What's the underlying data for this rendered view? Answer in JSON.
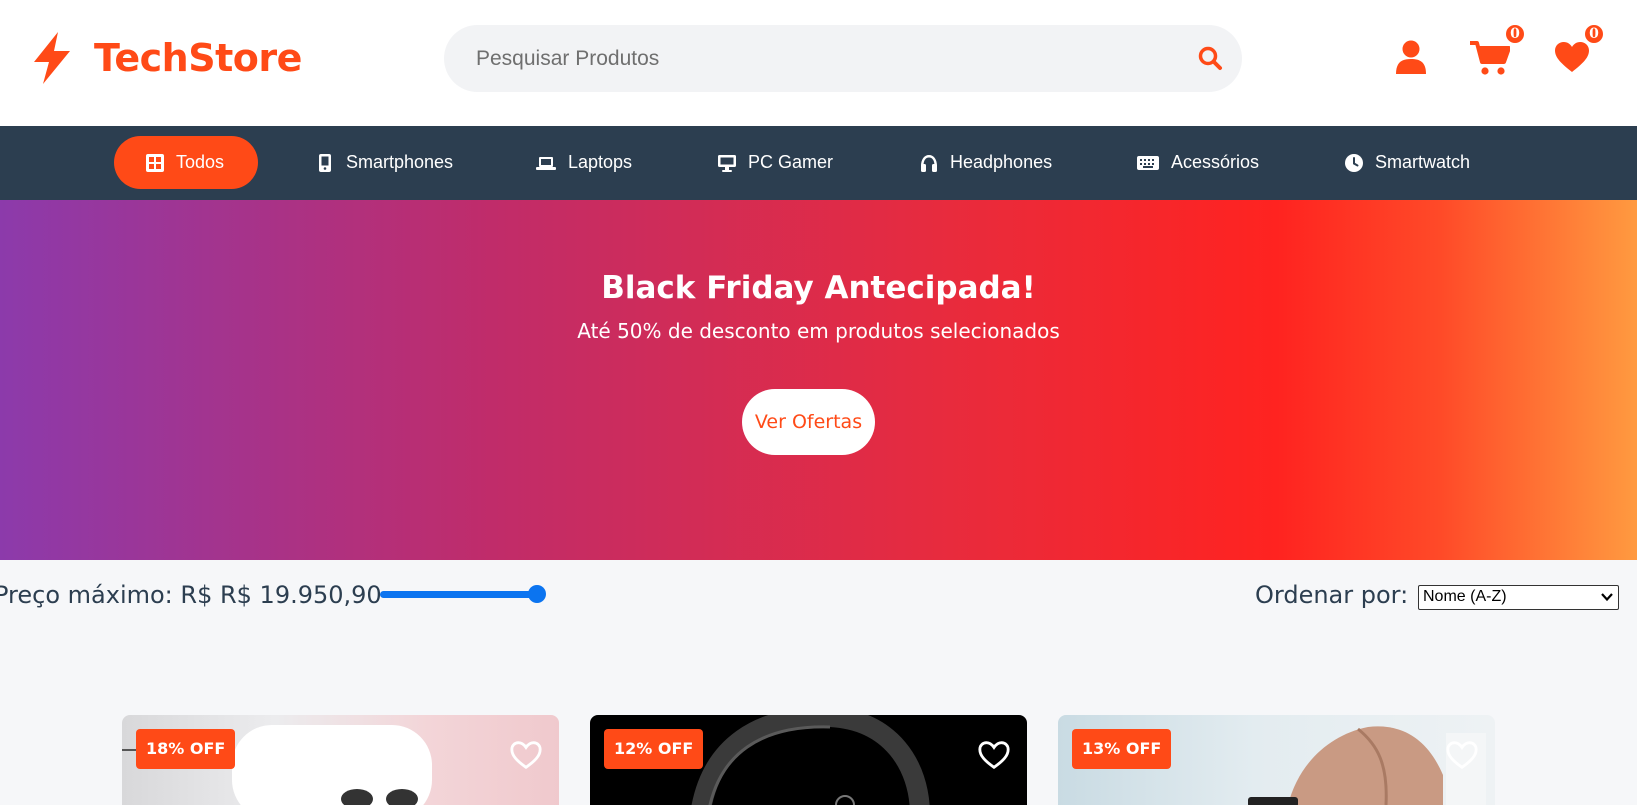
{
  "header": {
    "brand": "TechStore",
    "search_placeholder": "Pesquisar Produtos",
    "cart_count": "0",
    "wishlist_count": "0"
  },
  "nav": {
    "items": [
      {
        "label": "Todos",
        "icon": "grid-icon"
      },
      {
        "label": "Smartphones",
        "icon": "mobile-icon"
      },
      {
        "label": "Laptops",
        "icon": "laptop-icon"
      },
      {
        "label": "PC Gamer",
        "icon": "desktop-icon"
      },
      {
        "label": "Headphones",
        "icon": "headphones-icon"
      },
      {
        "label": "Acessórios",
        "icon": "keyboard-icon"
      },
      {
        "label": "Smartwatch",
        "icon": "clock-icon"
      }
    ]
  },
  "banner": {
    "title": "Black Friday Antecipada!",
    "subtitle": "Até 50% de desconto em produtos selecionados",
    "cta": "Ver Ofertas"
  },
  "filters": {
    "price_label": "Preço máximo: R$ R$ 19.950,90",
    "price_fraction": 1.0,
    "sort_label": "Ordenar por:",
    "sort_value": "Nome (A-Z)"
  },
  "products": [
    {
      "discount": "18% OFF"
    },
    {
      "discount": "12% OFF"
    },
    {
      "discount": "13% OFF"
    }
  ],
  "colors": {
    "accent": "#ff4a17",
    "nav_bg": "#2c3e50",
    "slider": "#0b74f0"
  }
}
